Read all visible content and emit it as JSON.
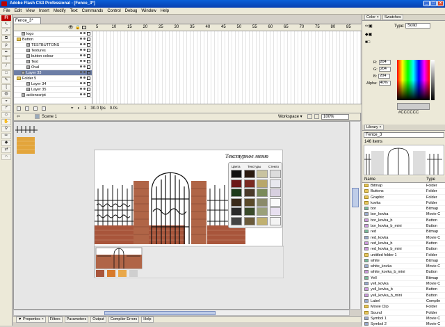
{
  "window": {
    "title": "Adobe Flash CS3 Professional - [Fence_3*]",
    "app_badge": "Fl"
  },
  "menu": [
    "File",
    "Edit",
    "View",
    "Insert",
    "Modify",
    "Text",
    "Commands",
    "Control",
    "Debug",
    "Window",
    "Help"
  ],
  "document": {
    "tab": "Fence_3*",
    "scene": "Scene 1",
    "workspace": "Workspace ▾",
    "zoom": "100%"
  },
  "timeline": {
    "ruler": [
      "5",
      "10",
      "15",
      "20",
      "25",
      "30",
      "35",
      "40",
      "45",
      "50",
      "55",
      "60",
      "65",
      "70",
      "75",
      "80",
      "85"
    ],
    "layers": [
      {
        "name": "logo",
        "indent": 1,
        "kind": "layer"
      },
      {
        "name": "Button",
        "indent": 0,
        "kind": "folder"
      },
      {
        "name": "TESTBUTTONS",
        "indent": 2,
        "kind": "layer"
      },
      {
        "name": "Textures",
        "indent": 2,
        "kind": "layer"
      },
      {
        "name": "button colour",
        "indent": 2,
        "kind": "layer"
      },
      {
        "name": "Text",
        "indent": 2,
        "kind": "layer"
      },
      {
        "name": "Oval",
        "indent": 2,
        "kind": "layer"
      },
      {
        "name": "Layer 33",
        "indent": 1,
        "kind": "layer",
        "selected": true
      },
      {
        "name": "Folder 5",
        "indent": 0,
        "kind": "folder"
      },
      {
        "name": "Layer 34",
        "indent": 2,
        "kind": "layer"
      },
      {
        "name": "Layer 35",
        "indent": 2,
        "kind": "layer"
      },
      {
        "name": "actionscript",
        "indent": 1,
        "kind": "layer"
      }
    ],
    "status": {
      "frame": "1",
      "fps": "30.0 fps",
      "time": "0.0s"
    }
  },
  "stage": {
    "menu_title": "Текстурное меню",
    "columns": [
      "Цвета",
      "Текстуры",
      "Стекло"
    ]
  },
  "bottom_tabs": [
    "▼ Properties ×",
    "Filters",
    "Parameters",
    "Output",
    "Compiler Errors",
    "Help"
  ],
  "color_panel": {
    "tabs": [
      "Color ×",
      "Swatches"
    ],
    "type_label": "Type:",
    "type_value": "Solid",
    "r_label": "R:",
    "r": "204",
    "g_label": "G:",
    "g": "204",
    "b_label": "B:",
    "b": "204",
    "alpha_label": "Alpha:",
    "alpha": "40%",
    "hex": "#CCCCCC"
  },
  "library": {
    "tab": "Library ×",
    "doc": "Fence_3",
    "count": "146 items",
    "col_name": "Name",
    "col_type": "Type",
    "items": [
      {
        "name": "Bitmap",
        "type": "Folder",
        "kind": "folder"
      },
      {
        "name": "Buttons",
        "type": "Folder",
        "kind": "folder"
      },
      {
        "name": "Graphic",
        "type": "Folder",
        "kind": "folder"
      },
      {
        "name": "kovka",
        "type": "Folder",
        "kind": "folder"
      },
      {
        "name": "bor",
        "type": "Bitmap",
        "kind": "bmp"
      },
      {
        "name": "bor_kovka",
        "type": "Movie C",
        "kind": "mc"
      },
      {
        "name": "bor_kovka_b",
        "type": "Button",
        "kind": "btn"
      },
      {
        "name": "bor_kovka_b_mini",
        "type": "Button",
        "kind": "btn"
      },
      {
        "name": "red",
        "type": "Bitmap",
        "kind": "bmp"
      },
      {
        "name": "red_kovka",
        "type": "Movie C",
        "kind": "mc"
      },
      {
        "name": "red_kovka_b",
        "type": "Button",
        "kind": "btn"
      },
      {
        "name": "red_kovka_b_mini",
        "type": "Button",
        "kind": "btn"
      },
      {
        "name": "untitled folder 1",
        "type": "Folder",
        "kind": "folder"
      },
      {
        "name": "white",
        "type": "Bitmap",
        "kind": "bmp"
      },
      {
        "name": "white_kovka",
        "type": "Movie C",
        "kind": "mc"
      },
      {
        "name": "white_kovka_b_mini",
        "type": "Button",
        "kind": "btn"
      },
      {
        "name": "Yell",
        "type": "Bitmap",
        "kind": "bmp"
      },
      {
        "name": "yell_kovka",
        "type": "Movie C",
        "kind": "mc"
      },
      {
        "name": "yell_kovka_b",
        "type": "Button",
        "kind": "btn"
      },
      {
        "name": "yell_kovka_b_mini",
        "type": "Button",
        "kind": "btn"
      },
      {
        "name": "Label",
        "type": "Compile",
        "kind": "mc"
      },
      {
        "name": "Movie Clip",
        "type": "Folder",
        "kind": "folder"
      },
      {
        "name": "Sound",
        "type": "Folder",
        "kind": "folder"
      },
      {
        "name": "Symbol 1",
        "type": "Movie C",
        "kind": "mc"
      },
      {
        "name": "Symbol 2",
        "type": "Movie C",
        "kind": "mc"
      }
    ]
  }
}
